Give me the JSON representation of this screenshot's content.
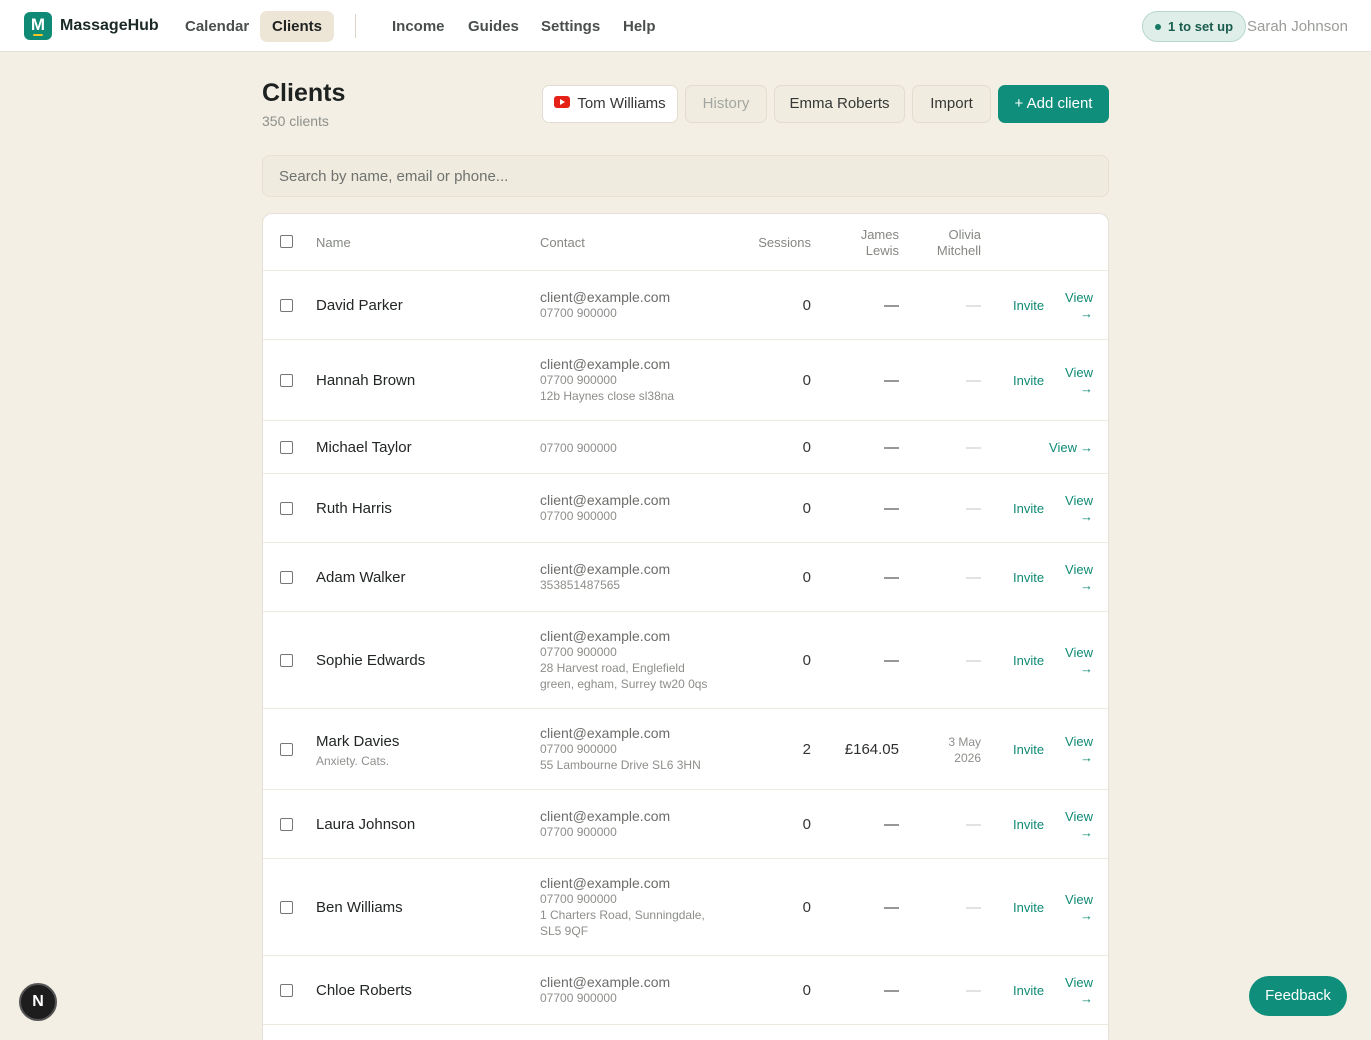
{
  "nav": {
    "brand": "MassageHub",
    "logo_letter": "M",
    "links": [
      "Calendar",
      "Clients",
      "Income",
      "Guides",
      "Settings",
      "Help"
    ],
    "setup_pill": "1 to set up",
    "user": "Sarah Johnson"
  },
  "header": {
    "title": "Clients",
    "subtitle": "350 clients",
    "buttons": {
      "video": "Tom Williams",
      "history": "History",
      "emma": "Emma Roberts",
      "import": "Import",
      "add": "+ Add client"
    }
  },
  "search": {
    "placeholder": "Search by name, email or phone..."
  },
  "table": {
    "columns": {
      "name": "Name",
      "contact": "Contact",
      "sessions": "Sessions",
      "col4": [
        "James",
        "Lewis"
      ],
      "col5": [
        "Olivia",
        "Mitchell"
      ]
    },
    "invite_label": "Invite",
    "view_label": "View",
    "view_arrow": "→",
    "rows": [
      {
        "name": "David Parker",
        "note": "",
        "email": "client@example.com",
        "lines": [
          "07700 900000"
        ],
        "sessions": "0",
        "amount": "—",
        "date": [
          "—"
        ],
        "invite": true
      },
      {
        "name": "Hannah Brown",
        "note": "",
        "email": "client@example.com",
        "lines": [
          "07700 900000",
          "12b Haynes close sl38na"
        ],
        "sessions": "0",
        "amount": "—",
        "date": [
          "—"
        ],
        "invite": true
      },
      {
        "name": "Michael Taylor",
        "note": "",
        "email": "",
        "lines": [
          "07700 900000"
        ],
        "sessions": "0",
        "amount": "—",
        "date": [
          "—"
        ],
        "invite": false
      },
      {
        "name": "Ruth Harris",
        "note": "",
        "email": "client@example.com",
        "lines": [
          "07700 900000"
        ],
        "sessions": "0",
        "amount": "—",
        "date": [
          "—"
        ],
        "invite": true
      },
      {
        "name": "Adam Walker",
        "note": "",
        "email": "client@example.com",
        "lines": [
          "353851487565"
        ],
        "sessions": "0",
        "amount": "—",
        "date": [
          "—"
        ],
        "invite": true
      },
      {
        "name": "Sophie Edwards",
        "note": "",
        "email": "client@example.com",
        "lines": [
          "07700 900000",
          "28 Harvest road, Englefield",
          "green, egham, Surrey tw20 0qs"
        ],
        "sessions": "0",
        "amount": "—",
        "date": [
          "—"
        ],
        "invite": true
      },
      {
        "name": "Mark Davies",
        "note": "Anxiety. Cats.",
        "email": "client@example.com",
        "lines": [
          "07700 900000",
          "55 Lambourne Drive SL6 3HN"
        ],
        "sessions": "2",
        "amount": "£164.05",
        "date": [
          "3 May",
          "2026"
        ],
        "invite": true
      },
      {
        "name": "Laura Johnson",
        "note": "",
        "email": "client@example.com",
        "lines": [
          "07700 900000"
        ],
        "sessions": "0",
        "amount": "—",
        "date": [
          "—"
        ],
        "invite": true
      },
      {
        "name": "Ben Williams",
        "note": "",
        "email": "client@example.com",
        "lines": [
          "07700 900000",
          "1 Charters Road, Sunningdale,",
          "SL5 9QF"
        ],
        "sessions": "0",
        "amount": "—",
        "date": [
          "—"
        ],
        "invite": true
      },
      {
        "name": "Chloe Roberts",
        "note": "",
        "email": "client@example.com",
        "lines": [
          "07700 900000"
        ],
        "sessions": "0",
        "amount": "—",
        "date": [
          "—"
        ],
        "invite": true
      }
    ]
  },
  "floating": {
    "next_badge": "N",
    "feedback": "Feedback"
  }
}
